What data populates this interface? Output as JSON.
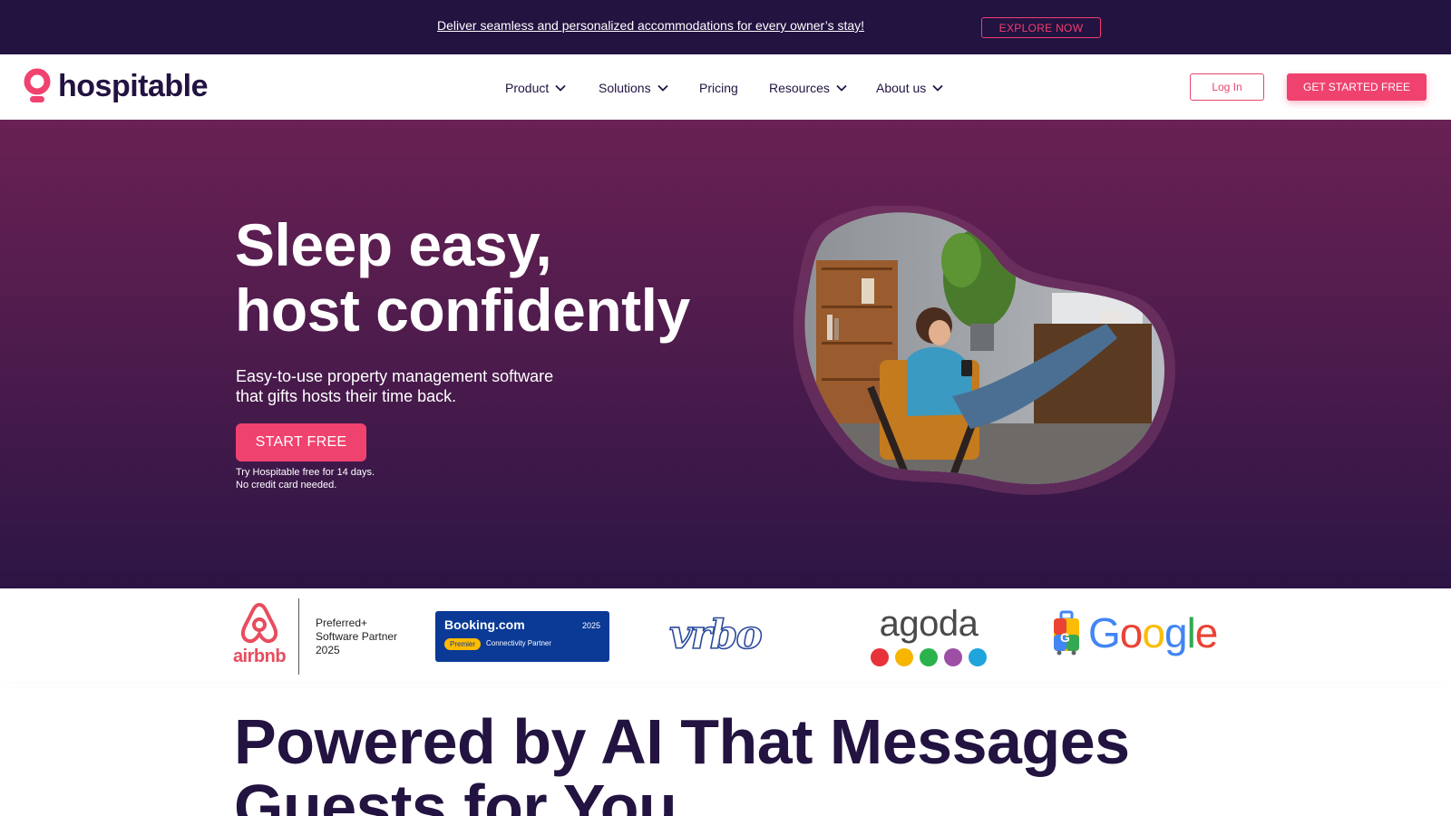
{
  "announcement": {
    "text": "Deliver seamless and personalized accommodations for every owner’s stay!",
    "cta": "EXPLORE NOW"
  },
  "header": {
    "brand": "hospitable",
    "nav": [
      {
        "label": "Product",
        "has_dropdown": true
      },
      {
        "label": "Solutions",
        "has_dropdown": true
      },
      {
        "label": "Pricing",
        "has_dropdown": false
      },
      {
        "label": "Resources",
        "has_dropdown": true
      },
      {
        "label": "About us",
        "has_dropdown": true
      }
    ],
    "login": "Log In",
    "get_started": "GET STARTED FREE",
    "dropdown_icon": "chevron-down-icon"
  },
  "hero": {
    "title_line1": "Sleep easy,",
    "title_line2": "host confidently",
    "subtitle_line1": "Easy-to-use property management software",
    "subtitle_line2": "that gifts hosts their time back.",
    "cta": "START FREE",
    "note_line1": "Try Hospitable free for 14 days.",
    "note_line2": "No credit card needed."
  },
  "partners": {
    "airbnb": {
      "wordmark": "airbnb",
      "line1": "Preferred+",
      "line2": "Software Partner",
      "line3": "2025"
    },
    "booking": {
      "name": "Booking.com",
      "year": "2025",
      "tier": "Premier",
      "partner": "Connectivity Partner"
    },
    "vrbo": {
      "wordmark": "vrbo"
    },
    "agoda": {
      "wordmark": "agoda"
    },
    "google": {
      "wordmark": "Google"
    }
  },
  "section": {
    "title_line1": "Powered by AI That Messages",
    "title_line2": "Guests for You"
  },
  "colors": {
    "brand_dark": "#221341",
    "accent_pink": "#f0426f",
    "hero_top": "#6a2153",
    "hero_bottom": "#2d1545",
    "booking_blue": "#0a3a96",
    "agoda_dots": [
      "#e8323a",
      "#f7b500",
      "#2bb24c",
      "#9c4fa5",
      "#1fa4dc"
    ]
  }
}
